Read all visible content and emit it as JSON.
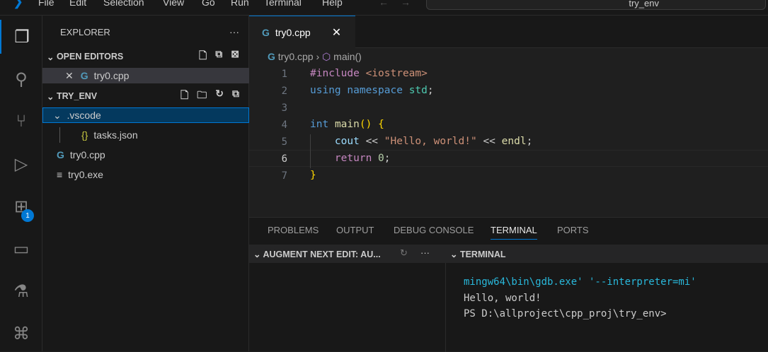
{
  "menu": [
    "File",
    "Edit",
    "Selection",
    "View",
    "Go",
    "Run",
    "Terminal",
    "Help"
  ],
  "search_text": "try_env",
  "activity_badge": "1",
  "explorer": {
    "title": "EXPLORER",
    "more": "···",
    "open_editors": "OPEN EDITORS",
    "open_file": "try0.cpp",
    "workspace": "TRY_ENV",
    "tree": [
      {
        "name": ".vscode",
        "type": "folder"
      },
      {
        "name": "tasks.json",
        "type": "json"
      },
      {
        "name": "try0.cpp",
        "type": "cpp"
      },
      {
        "name": "try0.exe",
        "type": "exe"
      }
    ]
  },
  "editor": {
    "tab": "try0.cpp",
    "breadcrumb_file": "try0.cpp",
    "breadcrumb_symbol": "main()",
    "lines": [
      "1",
      "2",
      "3",
      "4",
      "5",
      "6",
      "7"
    ]
  },
  "panel": {
    "tabs": [
      "PROBLEMS",
      "OUTPUT",
      "DEBUG CONSOLE",
      "TERMINAL",
      "PORTS"
    ],
    "augment": "AUGMENT NEXT EDIT: AU...",
    "terminal_title": "TERMINAL",
    "terminal_lines": [
      "mingw64\\bin\\gdb.exe' '--interpreter=mi'",
      "Hello, world!",
      "PS D:\\allproject\\cpp_proj\\try_env>"
    ]
  }
}
